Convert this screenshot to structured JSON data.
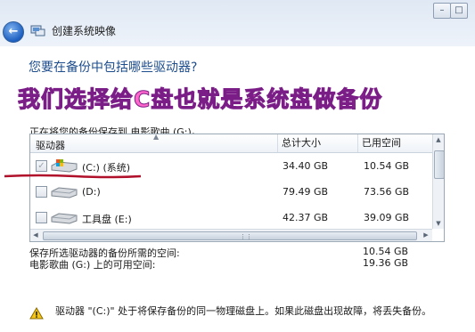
{
  "window": {
    "title": "创建系统映像",
    "back_glyph": "←",
    "min_glyph": "–",
    "max_glyph": "□"
  },
  "question": "您要在备份中包括哪些驱动器?",
  "annotation": "我们选择给C盘也就是系统盘做备份",
  "annotation_color": "#ff66cc",
  "save_note": "正在将您的备份保存到 电影歌曲 (G:)。",
  "table": {
    "columns": [
      "驱动器",
      "总计大小",
      "已用空间"
    ],
    "rows": [
      {
        "drive": "(C:) (系统)",
        "total": "34.40 GB",
        "used": "10.54 GB",
        "checked": true,
        "disabled": true,
        "icon": "windows-drive-icon"
      },
      {
        "drive": "(D:)",
        "total": "79.49 GB",
        "used": "73.56 GB",
        "checked": false,
        "disabled": false,
        "icon": "hard-drive-icon"
      },
      {
        "drive": "工具盘 (E:)",
        "total": "42.37 GB",
        "used": "39.09 GB",
        "checked": false,
        "disabled": false,
        "icon": "hard-drive-icon"
      }
    ]
  },
  "summary": {
    "required_label": "保存所选驱动器的备份所需的空间:",
    "required_value": "10.54 GB",
    "available_label": "电影歌曲 (G:) 上的可用空间:",
    "available_value": "19.36 GB"
  },
  "warning": "驱动器 \"(C:)\" 处于将保存备份的同一物理磁盘上。如果此磁盘出现故障，将丢失备份。"
}
